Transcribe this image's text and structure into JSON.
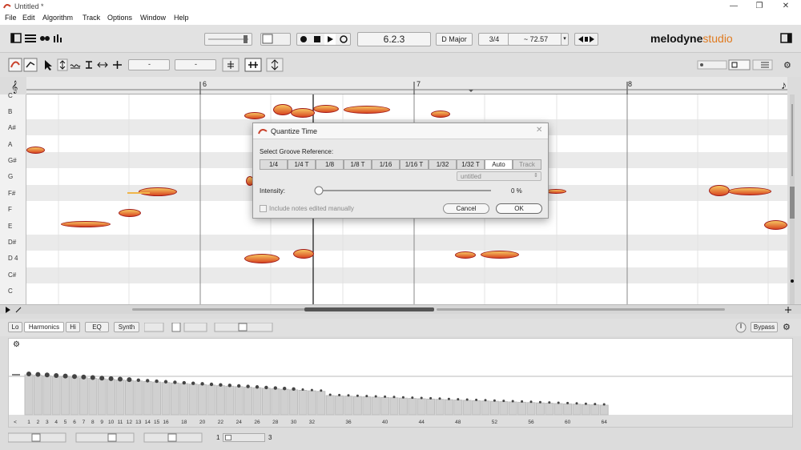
{
  "window": {
    "title": "Untitled *",
    "minimize": "—",
    "maximize": "❐",
    "close": "✕"
  },
  "menu": [
    "File",
    "Edit",
    "Algorithm",
    "Track",
    "Options",
    "Window",
    "Help"
  ],
  "toolbar": {
    "position": "6.2.3",
    "key": "D Major",
    "time_signature": "3/4",
    "tempo": "~ 72.57",
    "brand": "melodyne",
    "brand_suffix": "studio"
  },
  "ruler": {
    "bars": [
      "6",
      "7",
      "8"
    ]
  },
  "piano_keys": [
    "C",
    "B",
    "A#",
    "A",
    "G#",
    "G",
    "F#",
    "F",
    "E",
    "D#",
    "D 4",
    "C#",
    "C"
  ],
  "dialog": {
    "title": "Quantize Time",
    "groove_label": "Select Groove Reference:",
    "segments": [
      "1/4",
      "1/4 T",
      "1/8",
      "1/8 T",
      "1/16",
      "1/16 T",
      "1/32",
      "1/32 T",
      "Auto",
      "Track"
    ],
    "active_segment": "Auto",
    "track_select": "untitled",
    "intensity_label": "Intensity:",
    "intensity_value": "0 %",
    "intensity": 0,
    "include_notes_label": "Include notes edited manually",
    "include_notes_checked": false,
    "cancel_label": "Cancel",
    "ok_label": "OK"
  },
  "lower_panel": {
    "tabs": [
      "Lo",
      "Harmonics",
      "Hi",
      "EQ",
      "Synth"
    ],
    "active_tab": "Harmonics",
    "bypass_label": "Bypass",
    "harmonic_axis": [
      "<",
      "1",
      "2",
      "3",
      "4",
      "5",
      "6",
      "7",
      "8",
      "9",
      "10",
      "11",
      "12",
      "13",
      "14",
      "15",
      "16",
      "18",
      "20",
      "22",
      "24",
      "26",
      "28",
      "30",
      "32",
      "36",
      "40",
      "44",
      "48",
      "52",
      "56",
      "60",
      "64"
    ],
    "page_start": "1",
    "page_end": "3"
  },
  "colors": {
    "note_fill_top": "#f6c45f",
    "note_fill_bottom": "#d84822",
    "note_outline": "#a11a1a",
    "accent": "#3c78d8"
  }
}
